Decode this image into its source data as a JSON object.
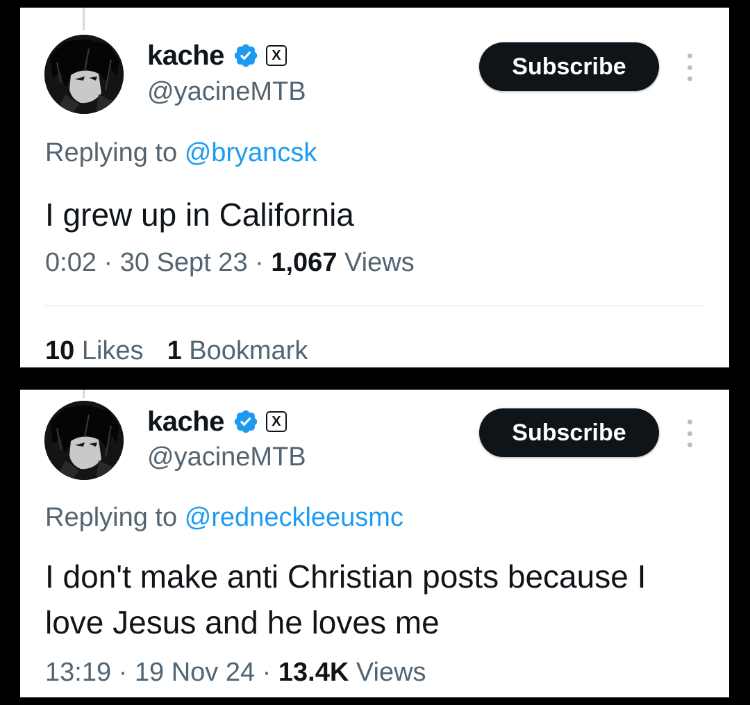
{
  "tweets": [
    {
      "author": {
        "name": "kache",
        "handle": "@yacineMTB",
        "verified": true,
        "badge": "X"
      },
      "subscribe_label": "Subscribe",
      "replying_prefix": "Replying to",
      "replying_to": "@bryancsk",
      "text": "I grew up in California",
      "time": "0:02",
      "sep": "·",
      "date": "30 Sept 23",
      "views_count": "1,067",
      "views_label": "Views",
      "stats": {
        "likes_count": "10",
        "likes_label": "Likes",
        "bookmarks_count": "1",
        "bookmarks_label": "Bookmark"
      }
    },
    {
      "author": {
        "name": "kache",
        "handle": "@yacineMTB",
        "verified": true,
        "badge": "X"
      },
      "subscribe_label": "Subscribe",
      "replying_prefix": "Replying to",
      "replying_to": "@redneckleeusmc",
      "text": "I don't make anti Christian posts because I love Jesus and he loves me",
      "time": "13:19",
      "sep": "·",
      "date": "19 Nov 24",
      "views_count": "13.4K",
      "views_label": "Views"
    }
  ],
  "colors": {
    "background": "#000000",
    "card": "#ffffff",
    "text_primary": "#0f1419",
    "text_secondary": "#536471",
    "link": "#1d9bf0",
    "verified": "#1d9bf0",
    "button": "#0f1419"
  },
  "icons": {
    "verified": "verified-check-icon",
    "platform": "x-logo-icon",
    "more": "more-vertical-icon"
  }
}
